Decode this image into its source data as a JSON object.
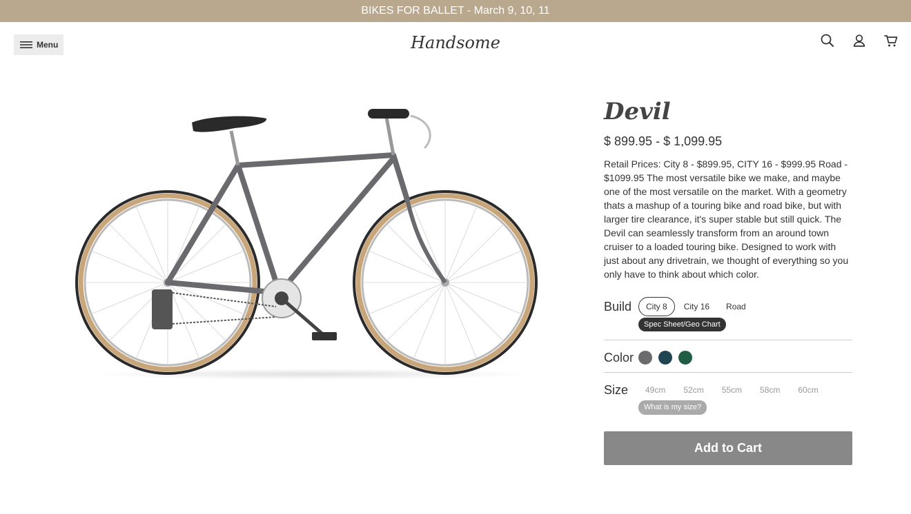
{
  "announcement": "BIKES FOR BALLET - March 9, 10, 11",
  "header": {
    "menu_label": "Menu",
    "logo_text": "Handsome",
    "icons": [
      "search-icon",
      "account-icon",
      "cart-icon"
    ]
  },
  "product": {
    "title": "Devil",
    "price": "$ 899.95 - $ 1,099.95",
    "description": "Retail Prices: City 8 - $899.95, CITY 16 - $999.95 Road - $1099.95 The most versatile bike we make, and maybe one of the most versatile on the market. With a geometry thats a mashup of a touring bike and road bike, but with larger tire clearance, it's super stable but still quick. The Devil can seamlessly transform from an around town cruiser to a loaded touring bike. Designed to work with just about any drivetrain, we thought of everything so you only have to think about which color.",
    "build": {
      "label": "Build",
      "options": [
        "City 8",
        "City 16",
        "Road"
      ],
      "selected": "City 8",
      "spec_link": "Spec Sheet/Geo Chart"
    },
    "color": {
      "label": "Color",
      "swatches": [
        "#6b6b6d",
        "#1f4452",
        "#1f5e45"
      ]
    },
    "size": {
      "label": "Size",
      "options": [
        "49cm",
        "52cm",
        "55cm",
        "58cm",
        "60cm"
      ],
      "help_link": "What is my size?"
    },
    "add_to_cart": "Add to Cart"
  },
  "colors": {
    "announcement_bg": "#b9a88e",
    "add_button_bg": "#888888"
  }
}
